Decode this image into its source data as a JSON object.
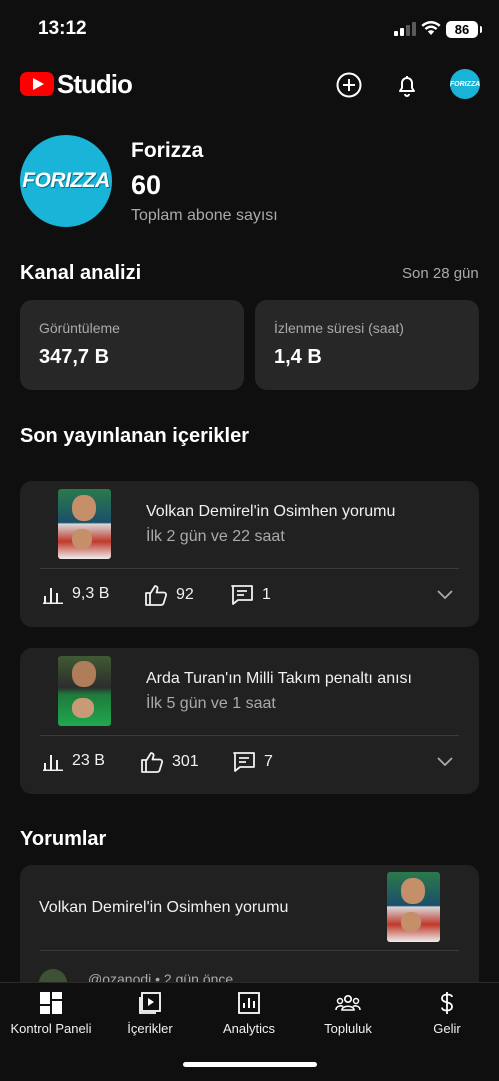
{
  "status_bar": {
    "time": "13:12",
    "battery": "86"
  },
  "header": {
    "logo_text": "Studio",
    "avatar_text": "FORIZZA",
    "icons": [
      "plus-circle-icon",
      "bell-icon"
    ]
  },
  "channel": {
    "avatar_text": "FORIZZA",
    "name": "Forizza",
    "subscribers": "60",
    "subscribers_label": "Toplam abone sayısı"
  },
  "analytics": {
    "title": "Kanal analizi",
    "period": "Son 28 gün",
    "cards": [
      {
        "label": "Görüntüleme",
        "value": "347,7 B"
      },
      {
        "label": "İzlenme süresi (saat)",
        "value": "1,4 B"
      }
    ]
  },
  "recent": {
    "title": "Son yayınlanan içerikler",
    "videos": [
      {
        "title": "Volkan Demirel'in Osimhen yorumu",
        "age": "İlk 2 gün ve 22 saat",
        "views": "9,3 B",
        "likes": "92",
        "comments": "1"
      },
      {
        "title": "Arda Turan'ın Milli Takım penaltı anısı",
        "age": "İlk 5 gün ve 1 saat",
        "views": "23 B",
        "likes": "301",
        "comments": "7"
      }
    ]
  },
  "comments": {
    "title": "Yorumlar",
    "item": {
      "video_title": "Volkan Demirel'in Osimhen yorumu",
      "user_line": "@ozanodi • 2 gün önce"
    }
  },
  "bottom_nav": [
    {
      "label": "Kontrol Paneli",
      "icon": "dashboard-icon"
    },
    {
      "label": "İçerikler",
      "icon": "content-icon"
    },
    {
      "label": "Analytics",
      "icon": "analytics-icon"
    },
    {
      "label": "Topluluk",
      "icon": "community-icon"
    },
    {
      "label": "Gelir",
      "icon": "dollar-icon"
    }
  ]
}
